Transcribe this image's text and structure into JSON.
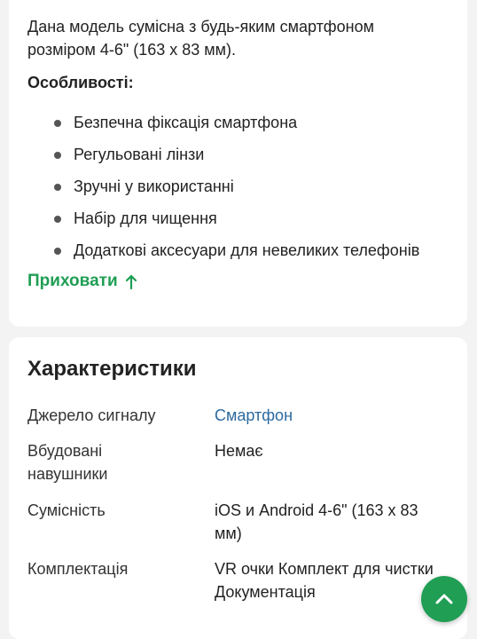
{
  "description": {
    "text": "Дана модель сумісна з будь-яким смартфоном розміром 4-6\" (163 х 83 мм).",
    "features_title": "Особливості:",
    "features": [
      "Безпечна фіксація смартфона",
      "Регульовані лінзи",
      "Зручні у використанні",
      "Набір для чищення",
      "Додаткові аксесуари для невеликих телефонів"
    ],
    "hide_label": "Приховати"
  },
  "specs": {
    "title": "Характеристики",
    "rows": [
      {
        "label": "Джерело сигналу",
        "value": "Смартфон"
      },
      {
        "label": "Вбудовані навушники",
        "value": "Немає"
      },
      {
        "label": "Сумісність",
        "value": "iOS и Android 4-6\" (163 х 83 мм)"
      },
      {
        "label": "Комплектація",
        "value": "VR очки Комплект для чистки Документація"
      }
    ]
  },
  "icons": {
    "hide_arrow": "arrow-up-icon",
    "scroll_top": "chevron-up-icon"
  },
  "colors": {
    "accent_green": "#1f9e54",
    "link_blue": "#2c6aa0"
  }
}
